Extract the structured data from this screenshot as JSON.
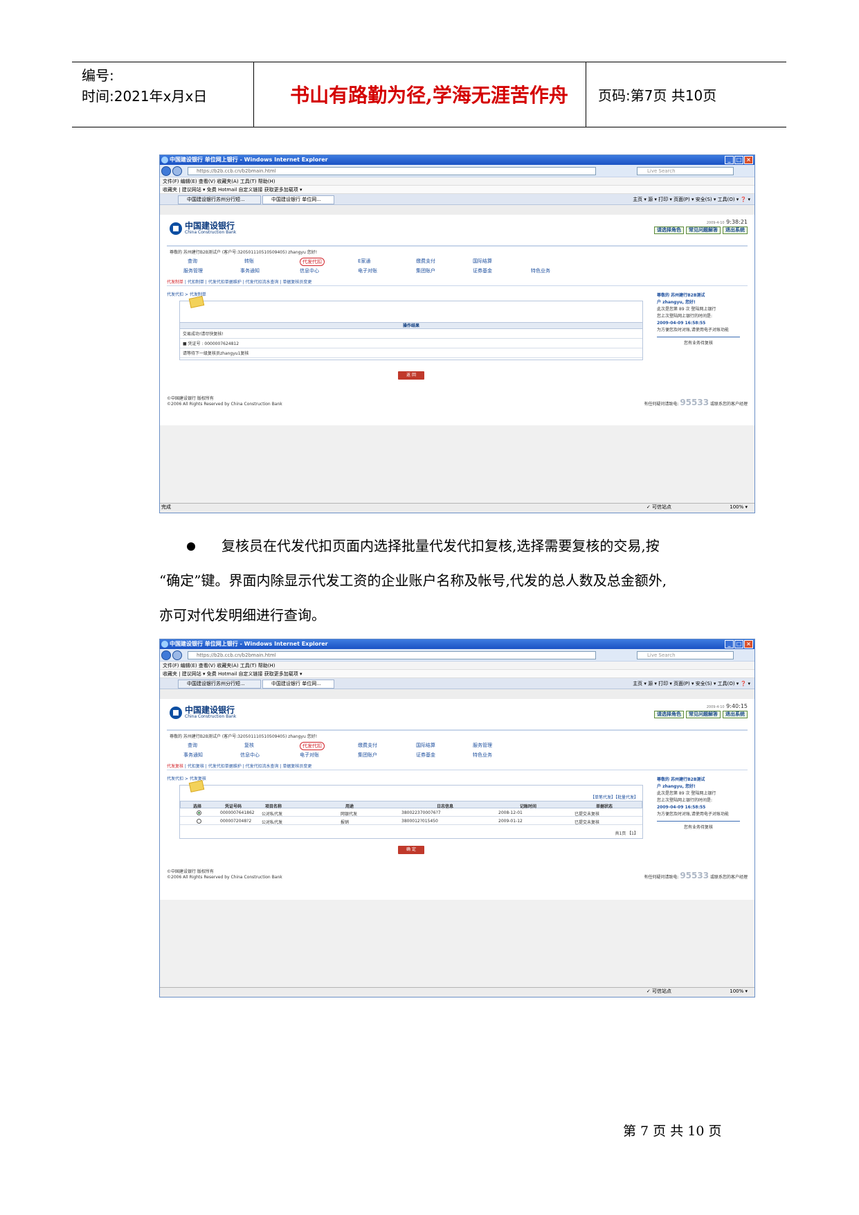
{
  "header": {
    "number_label": "编号:",
    "time_label": "时间:2021年x月x日",
    "motto": "书山有路勤为径,学海无涯苦作舟",
    "page_label": "页码:第7页 共10页"
  },
  "browser": {
    "title": "中国建设银行 单位网上银行 - Windows Internet Explorer",
    "url": "https://b2b.ccb.cn/b2bmain.html",
    "search_placeholder": "Live Search",
    "menubar": "文件(F)  编辑(E)  查看(V)  收藏夹(A)  工具(T)  帮助(H)",
    "favbar": "收藏夹 | 建议网站 ▾  免费 Hotmail  自定义链接  获取更多加载项 ▾",
    "tab1": "中国建设银行苏州分行短...",
    "tab2": "中国建设银行 单位网...",
    "tab_tools": "主页 ▾  源 ▾  打印 ▾  页面(P) ▾  安全(S) ▾  工具(O) ▾  ❓ ▾",
    "status_done": "完成",
    "status_trusted": "✓ 可信站点",
    "status_zoom": "100% ▾"
  },
  "bank": {
    "logo_cn": "中国建设银行",
    "logo_en": "China Construction Bank",
    "role_select": "请选择角色",
    "help_btn": "常见问题解答",
    "exit_btn": "退出系统",
    "welcome": "尊敬的 苏州建行B2B测试户 (客户号:320501110510509405) zhangyu 您好!",
    "footer_copyright1": "©中国建设银行 版权所有",
    "footer_copyright2": "©2006 All Rights Reserved by China Construction Bank",
    "footer_hotline_prefix": "有任何疑问请致电:",
    "footer_hotline": "95533",
    "footer_hotline_suffix": "或联系您的客户经理",
    "side_user_line1": "尊敬的 苏州建行B2B测试",
    "side_user_line2": "户 zhangyu, 您好!",
    "side_login_count": "此次是您第 89 次 登陆网上银行",
    "side_last_login": "您上次登陆网上银行的时间是:",
    "side_last_time": "2009-04-09 16:58:55",
    "side_tip": "为方便您及时对账,请使用电子对账功能",
    "side_business": "您有业务待复核"
  },
  "screen1": {
    "clock_date": "2009-4-10",
    "clock_time": "9:38:21",
    "menu_row1": [
      "查询",
      "转账",
      "代发代扣",
      "E家通",
      "缴费支付",
      "国际结算"
    ],
    "menu_row2": [
      "服务管理",
      "事务通知",
      "信息中心",
      "电子对账",
      "集团账户",
      "证券基金",
      "特色业务"
    ],
    "submenu_active": "代发制单",
    "submenu_rest": " | 代扣制单 | 代发代扣单据维护 | 代发代扣流水查询 | 单据复核员变更",
    "crumb": "代发代扣 > 代发制单",
    "result_title": "操作结果",
    "result_line1": "交易成功!请尽快复核!",
    "result_line2": "■      凭证号      : 0000007624812",
    "result_line3": "请等待下一级复核员zhangyu1复核",
    "back_btn": "返 回"
  },
  "para": {
    "line1": "复核员在代发代扣页面内选择批量代发代扣复核,选择需要复核的交易,按",
    "line2": "“确定”键。界面内除显示代发工资的企业账户名称及帐号,代发的总人数及总金额外,",
    "line3": "亦可对代发明细进行查询。"
  },
  "screen2": {
    "clock_date": "2009-4-10",
    "clock_time": "9:40:15",
    "menu_row1": [
      "查询",
      "复核",
      "代发代扣",
      "缴费支付",
      "国际结算",
      "服务管理"
    ],
    "menu_row2": [
      "事务通知",
      "信息中心",
      "电子对账",
      "集团账户",
      "证券基金",
      "特色业务"
    ],
    "submenu_active": "代发复核",
    "submenu_rest": " | 代扣复核 | 代发代扣单据维护 | 代发代扣流水查询 | 单据复核员变更",
    "crumb": "代发代扣 > 代发复核",
    "filter_links": "【单笔代发】【批量代发】",
    "columns": [
      "选择",
      "凭证号码",
      "项目名称",
      "用途",
      "日志信息",
      "记账时间",
      "单据状态"
    ],
    "rows": [
      {
        "selected": true,
        "voucher": "0000007641862",
        "project": "公对私代发",
        "usage": "网银代发",
        "log": "3800223700076?7",
        "date": "2008-12-01",
        "status": "已提交未复核"
      },
      {
        "selected": false,
        "voucher": "0000072048?2",
        "project": "公对私代发",
        "usage": "报销",
        "log": "3800012?015450",
        "date": "2009-01-12",
        "status": "已提交未复核"
      }
    ],
    "pager": "共1页 【1】",
    "confirm_btn": "确 定"
  },
  "footer": {
    "page": "第 7 页 共 10 页"
  }
}
